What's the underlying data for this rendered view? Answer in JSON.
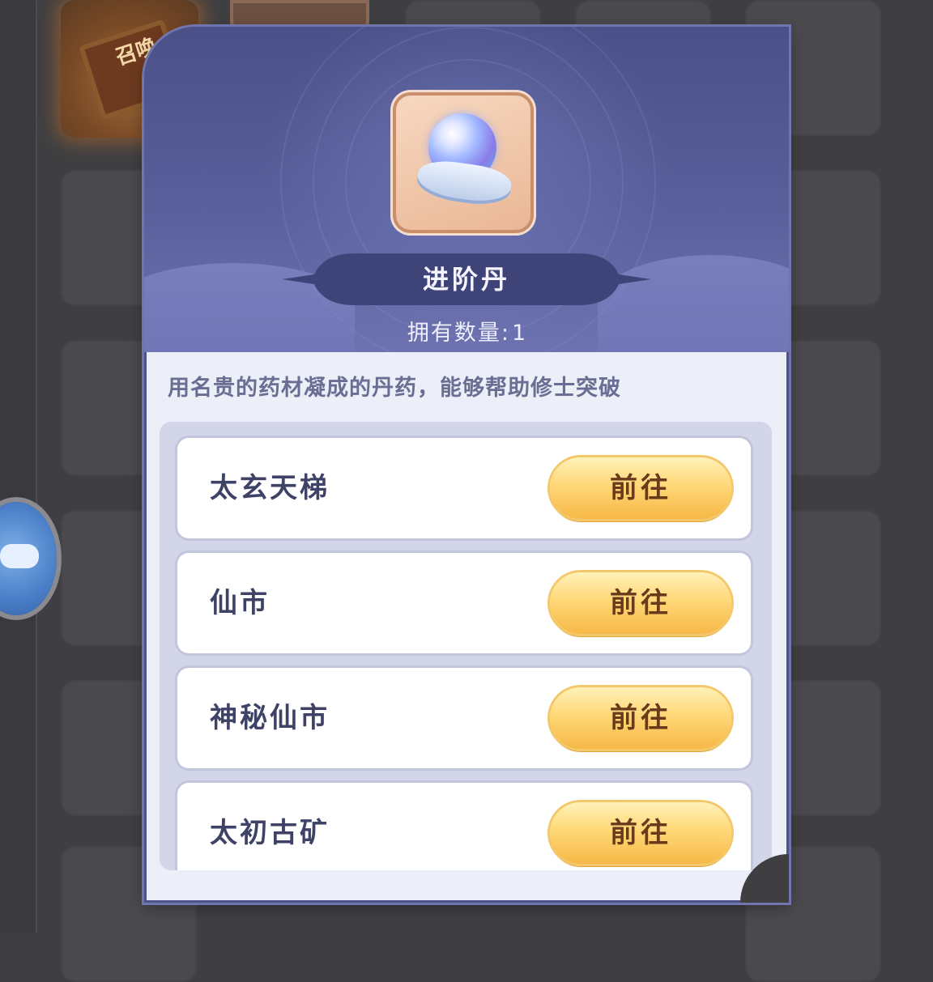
{
  "background": {
    "scroll_item_text": "召唤"
  },
  "dialog": {
    "item_icon": "pearl-on-cloth-icon",
    "item_name": "进阶丹",
    "quantity_label": "拥有数量:",
    "quantity_value": "1",
    "description": "用名贵的药材凝成的丹药，能够帮助修士突破",
    "sources": [
      {
        "label": "太玄天梯",
        "button": "前往"
      },
      {
        "label": "仙市",
        "button": "前往"
      },
      {
        "label": "神秘仙市",
        "button": "前往"
      },
      {
        "label": "太初古矿",
        "button": "前往"
      }
    ]
  },
  "colors": {
    "header": "#4e5389",
    "button": "#ffd878",
    "body": "#eceff8"
  }
}
